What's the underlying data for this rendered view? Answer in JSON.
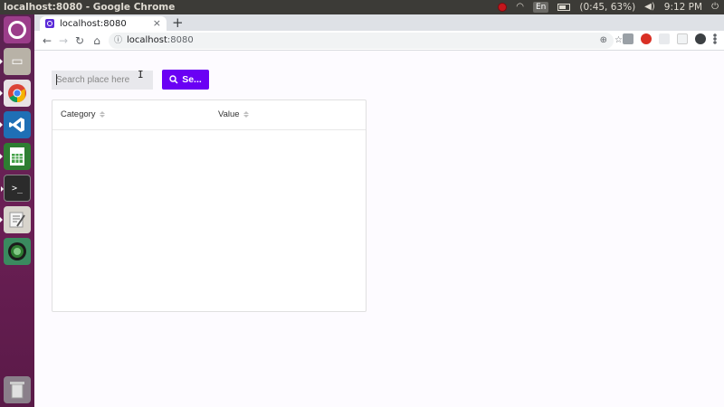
{
  "os": {
    "window_title": "localhost:8080 - Google Chrome",
    "keyboard_layout": "En",
    "battery": "(0:45, 63%)",
    "clock": "9:12 PM"
  },
  "launcher": {
    "items": [
      "ubuntu-dash",
      "files",
      "chrome",
      "vscode",
      "spreadsheet",
      "terminal",
      "text-editor",
      "globe-app",
      "trash"
    ],
    "terminal_glyph": ">_"
  },
  "browser": {
    "tab_title": "localhost:8080",
    "tab_close": "×",
    "new_tab": "+",
    "url_host": "localhost",
    "url_port": ":8080",
    "info_glyph": "ⓘ",
    "nav": {
      "back": "←",
      "forward": "→",
      "reload": "↻",
      "home": "⌂"
    },
    "right_icons": {
      "cast": "⊕",
      "bookmark": "☆"
    }
  },
  "page": {
    "search": {
      "placeholder": "Search place here",
      "value": "",
      "button_label": "Se..."
    },
    "table": {
      "columns": [
        "Category",
        "Value"
      ],
      "rows": []
    }
  },
  "colors": {
    "accent": "#6a00f4",
    "launcher_bg": "#5a2351",
    "topbar_bg": "#3c3b37"
  }
}
